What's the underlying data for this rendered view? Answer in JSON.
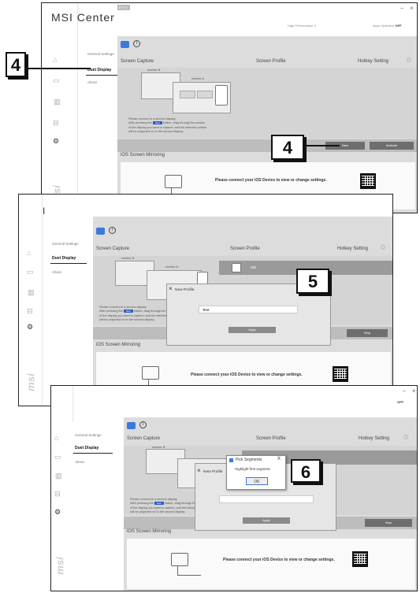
{
  "app": {
    "name": "MSI Center",
    "edition": "PRO",
    "logo_short": "MSI",
    "sidebar_logo": "msi"
  },
  "header": {
    "mode": "High Performance",
    "mode_caret": "▼",
    "optimizer": "Apps Optimizer",
    "optimizer_state": "OFF"
  },
  "window_controls": {
    "minimize": "–",
    "close": "×"
  },
  "submenu": {
    "general": "General Settings",
    "duet": "Duet Display",
    "about": "About"
  },
  "sections": {
    "screen_capture": "Screen Capture",
    "screen_profile": "Screen Profile",
    "hotkey": "Hotkey Setting",
    "ios": "iOS Screen Mirroring"
  },
  "monitors": {
    "b": "monitor B",
    "a": "monitor A",
    "seg1": "1",
    "seg2": "2",
    "seg3": "3",
    "seg4": "4"
  },
  "prompt": {
    "l1": "Please connect to a second display.",
    "l2a": "After pressing the",
    "new_inline": "New",
    "l2b": "button, drag through the portion",
    "l3": "of the display you want to capture, and the selected portion",
    "l4": "will be projected on to the second display."
  },
  "buttons": {
    "new": "New",
    "activate": "Activate",
    "stop": "Stop",
    "apply": "Apply",
    "ok": "OK"
  },
  "ios_msg": "Please connect your iOS Device to view or change settings.",
  "profile": {
    "name": "MD"
  },
  "dialog": {
    "title": "New Profile",
    "close": "×",
    "value": "Test"
  },
  "pick": {
    "title": "Pick Segments",
    "close": "X",
    "msg": "Highlight first segment."
  },
  "callouts": {
    "c1": "4",
    "c2": "4",
    "c3": "5",
    "c4": "6"
  },
  "icons": {
    "info": "info-icon",
    "gear": "gear-icon",
    "home": "home-icon",
    "monitor": "monitor-icon",
    "chart": "chart-icon",
    "toolbox": "toolbox-icon",
    "settings": "settings-icon",
    "tablet": "tablet-icon",
    "duet": "duet-logo-icon"
  }
}
